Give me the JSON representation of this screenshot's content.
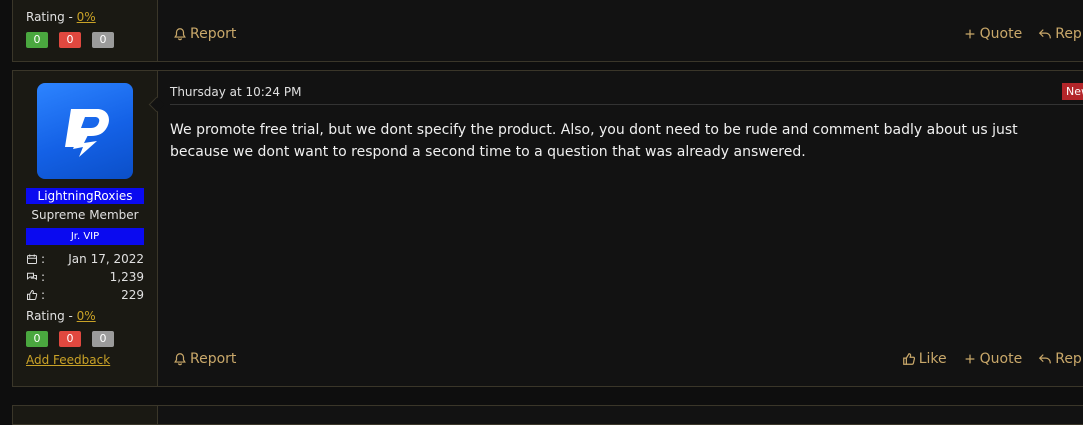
{
  "top_post": {
    "rating_label": "Rating - ",
    "rating_pct": "0%",
    "ratings": [
      "0",
      "0",
      "0"
    ],
    "report": "Report",
    "quote": "Quote",
    "reply": "Reply"
  },
  "main_post": {
    "user": {
      "name": "LightningRoxies",
      "title": "Supreme Member",
      "banner": "Jr. VIP",
      "joined": "Jan 17, 2022",
      "messages": "1,239",
      "reactions": "229",
      "stat_sep": ":",
      "rating_label": "Rating - ",
      "rating_pct": "0%",
      "ratings": [
        "0",
        "0",
        "0"
      ],
      "feedback": "Add Feedback"
    },
    "timestamp": "Thursday at 10:24 PM",
    "new_badge": "New",
    "body": "We promote free trial, but we dont specify the product. Also, you dont need to be rude and comment badly about us just because we dont want to respond a second time to a question that was already answered.",
    "report": "Report",
    "like": "Like",
    "quote": "Quote",
    "reply": "Reply"
  },
  "colors": {
    "accent": "#c9a86a",
    "link": "#c9a227",
    "username_bg": "#0a0af0",
    "new_badge": "#b3262a"
  },
  "icons": [
    "bell-icon",
    "plus-icon",
    "reply-icon",
    "thumbs-up-icon",
    "calendar-icon",
    "messages-icon",
    "reactions-icon",
    "lightning-logo"
  ]
}
